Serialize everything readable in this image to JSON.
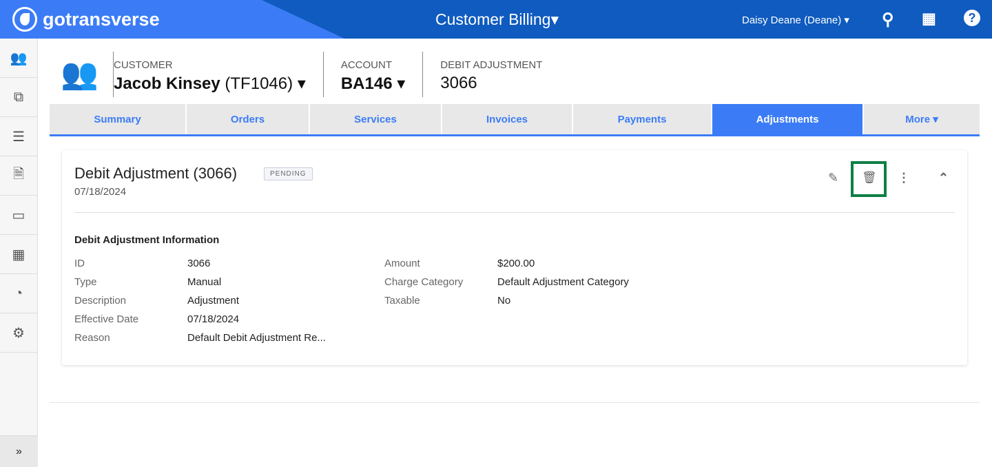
{
  "app": {
    "brand": "gotransverse",
    "title": "Customer Billing",
    "user": "Daisy Deane (Deane)"
  },
  "sidebar": {
    "items": [
      "customers-icon",
      "documents-icon",
      "servers-icon",
      "file-icon",
      "credit-card-icon",
      "calculator-icon",
      "dashboard-icon",
      "gear-icon"
    ],
    "expand": "»"
  },
  "header": {
    "customer_label": "CUSTOMER",
    "customer_name": "Jacob Kinsey",
    "customer_id": "(TF1046)",
    "account_label": "ACCOUNT",
    "account": "BA146",
    "adj_label": "DEBIT ADJUSTMENT",
    "adj": "3066"
  },
  "tabs": [
    {
      "label": "Summary"
    },
    {
      "label": "Orders"
    },
    {
      "label": "Services"
    },
    {
      "label": "Invoices"
    },
    {
      "label": "Payments"
    },
    {
      "label": "Adjustments",
      "active": true
    },
    {
      "label": "More ▾"
    }
  ],
  "card": {
    "title": "Debit Adjustment (3066)",
    "status": "PENDING",
    "date": "07/18/2024",
    "section": "Debit Adjustment Information",
    "left": [
      {
        "k": "ID",
        "v": "3066"
      },
      {
        "k": "Type",
        "v": "Manual"
      },
      {
        "k": "Description",
        "v": "Adjustment"
      },
      {
        "k": "Effective Date",
        "v": "07/18/2024"
      },
      {
        "k": "Reason",
        "v": "Default Debit Adjustment Re..."
      }
    ],
    "right": [
      {
        "k": "Amount",
        "v": "$200.00"
      },
      {
        "k": "Charge Category",
        "v": "Default Adjustment Category"
      },
      {
        "k": "Taxable",
        "v": "No"
      }
    ]
  },
  "colors": {
    "brand": "#3b7cf6",
    "header_dark": "#0f5bbf",
    "highlight": "#0d7f44"
  }
}
